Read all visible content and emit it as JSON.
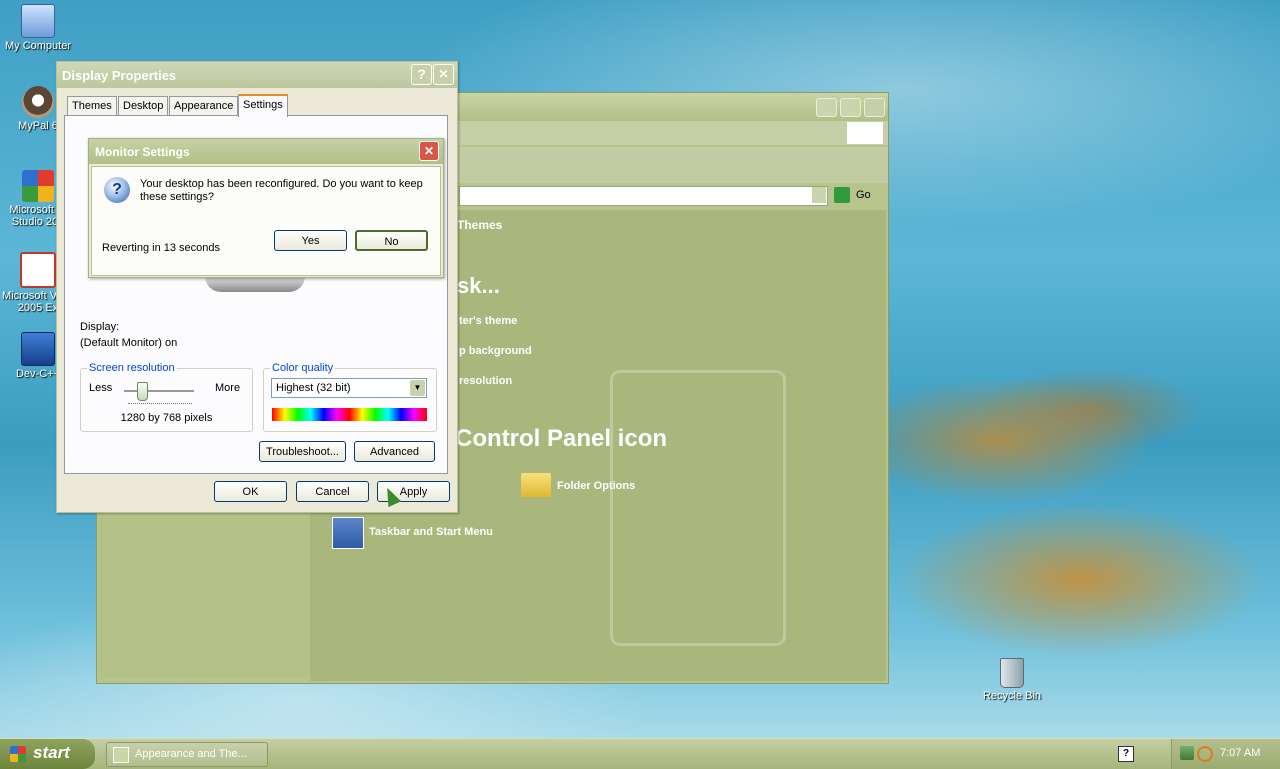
{
  "desktop": {
    "icons": [
      {
        "label": "My Computer",
        "icon": "my-computer-icon"
      },
      {
        "label": "MyPal 6",
        "icon": "mypal-icon"
      },
      {
        "label": "Microsoft Vi Studio 200",
        "icon": "visual-studio-icon"
      },
      {
        "label": "Microsoft Vi J# 2005 Ex",
        "icon": "vj-sharp-icon"
      },
      {
        "label": "Dev-C++",
        "icon": "dev-cpp-icon"
      },
      {
        "label": "Recycle Bin",
        "icon": "recycle-bin-icon"
      }
    ]
  },
  "control_panel": {
    "address_go": "Go",
    "header_fragment": "Themes",
    "pick_task_fragment": "sk...",
    "tasks": [
      "ter's theme",
      "p background",
      "resolution"
    ],
    "pick_icon_heading": "Control Panel icon",
    "items": [
      "Folder Options",
      "Taskbar and Start Menu"
    ]
  },
  "display_properties": {
    "title": "Display Properties",
    "help_button": "?",
    "close_button": "✕",
    "tabs": [
      "Themes",
      "Desktop",
      "Appearance",
      "Settings"
    ],
    "selected_tab": "Settings",
    "display_label": "Display:",
    "display_value": "(Default Monitor) on",
    "screen_resolution": {
      "legend": "Screen resolution",
      "less": "Less",
      "more": "More",
      "value": "1280 by 768 pixels",
      "slider_level": 0.25
    },
    "color_quality": {
      "legend": "Color quality",
      "selected": "Highest (32 bit)"
    },
    "buttons": {
      "troubleshoot": "Troubleshoot...",
      "advanced": "Advanced",
      "ok": "OK",
      "cancel": "Cancel",
      "apply": "Apply"
    }
  },
  "monitor_settings": {
    "title": "Monitor Settings",
    "message": "Your desktop has been reconfigured.  Do you want to keep these settings?",
    "countdown": "Reverting in 13 seconds",
    "yes": "Yes",
    "no": "No"
  },
  "taskbar": {
    "start": "start",
    "task_button": "Appearance and The...",
    "clock": "7:07 AM"
  }
}
